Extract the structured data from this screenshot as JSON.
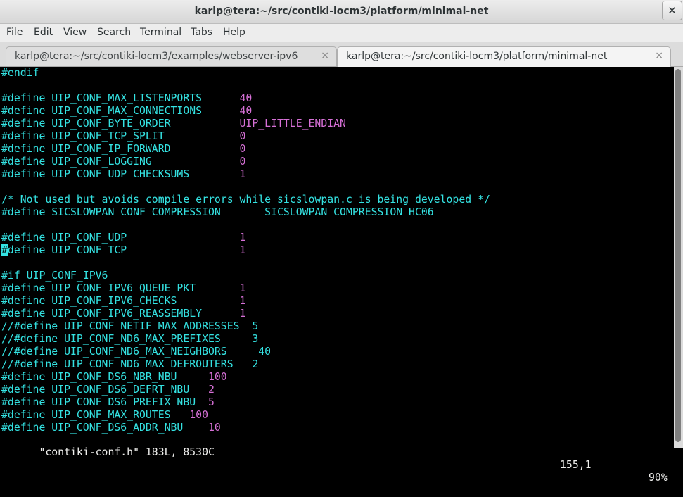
{
  "window": {
    "title": "karlp@tera:~/src/contiki-locm3/platform/minimal-net",
    "close_glyph": "✕"
  },
  "menu": [
    "File",
    "Edit",
    "View",
    "Search",
    "Terminal",
    "Tabs",
    "Help"
  ],
  "tabs": [
    {
      "label": "karlp@tera:~/src/contiki-locm3/examples/webserver-ipv6",
      "close_glyph": "×",
      "active": false
    },
    {
      "label": "karlp@tera:~/src/contiki-locm3/platform/minimal-net",
      "close_glyph": "×",
      "active": true
    }
  ],
  "code_lines": [
    {
      "key": "#endif",
      "value": ""
    },
    {
      "key": "",
      "value": ""
    },
    {
      "key": "#define UIP_CONF_MAX_LISTENPORTS",
      "value": "40"
    },
    {
      "key": "#define UIP_CONF_MAX_CONNECTIONS",
      "value": "40"
    },
    {
      "key": "#define UIP_CONF_BYTE_ORDER",
      "value": "UIP_LITTLE_ENDIAN"
    },
    {
      "key": "#define UIP_CONF_TCP_SPLIT",
      "value": "0"
    },
    {
      "key": "#define UIP_CONF_IP_FORWARD",
      "value": "0"
    },
    {
      "key": "#define UIP_CONF_LOGGING",
      "value": "0"
    },
    {
      "key": "#define UIP_CONF_UDP_CHECKSUMS",
      "value": "1"
    },
    {
      "key": "",
      "value": ""
    },
    {
      "key": "/* Not used but avoids compile errors while sicslowpan.c is being developed */",
      "value": ""
    },
    {
      "key": "#define SICSLOWPAN_CONF_COMPRESSION",
      "value": "SICSLOWPAN_COMPRESSION_HC06"
    },
    {
      "key": "",
      "value": ""
    },
    {
      "key": "#define UIP_CONF_UDP",
      "value": "1"
    },
    {
      "key": "#define UIP_CONF_TCP",
      "value": "1"
    },
    {
      "key": "",
      "value": ""
    },
    {
      "key": "#if UIP_CONF_IPV6",
      "value": ""
    },
    {
      "key": "#define UIP_CONF_IPV6_QUEUE_PKT",
      "value": "1"
    },
    {
      "key": "#define UIP_CONF_IPV6_CHECKS",
      "value": "1"
    },
    {
      "key": "#define UIP_CONF_IPV6_REASSEMBLY",
      "value": "1"
    },
    {
      "key": "//#define UIP_CONF_NETIF_MAX_ADDRESSES",
      "value": "5"
    },
    {
      "key": "//#define UIP_CONF_ND6_MAX_PREFIXES",
      "value": "3"
    },
    {
      "key": "//#define UIP_CONF_ND6_MAX_NEIGHBORS",
      "value": "40"
    },
    {
      "key": "//#define UIP_CONF_ND6_MAX_DEFROUTERS",
      "value": "2"
    },
    {
      "key": "#define UIP_CONF_DS6_NBR_NBU",
      "value": "100"
    },
    {
      "key": "#define UIP_CONF_DS6_DEFRT_NBU",
      "value": "2"
    },
    {
      "key": "#define UIP_CONF_DS6_PREFIX_NBU",
      "value": "5"
    },
    {
      "key": "#define UIP_CONF_MAX_ROUTES",
      "value": "100"
    },
    {
      "key": "#define UIP_CONF_DS6_ADDR_NBU",
      "value": "10"
    }
  ],
  "status": {
    "file_info": "\"contiki-conf.h\" 183L, 8530C",
    "cursor_pos": "155,1",
    "scroll_pct": "90%"
  },
  "colors": {
    "preprocessor": "#34e2e2",
    "number": "#ad7fa8",
    "identifier_value": "#d670d6",
    "comment_line": "#34e2e2",
    "text": "#eeeeec"
  }
}
